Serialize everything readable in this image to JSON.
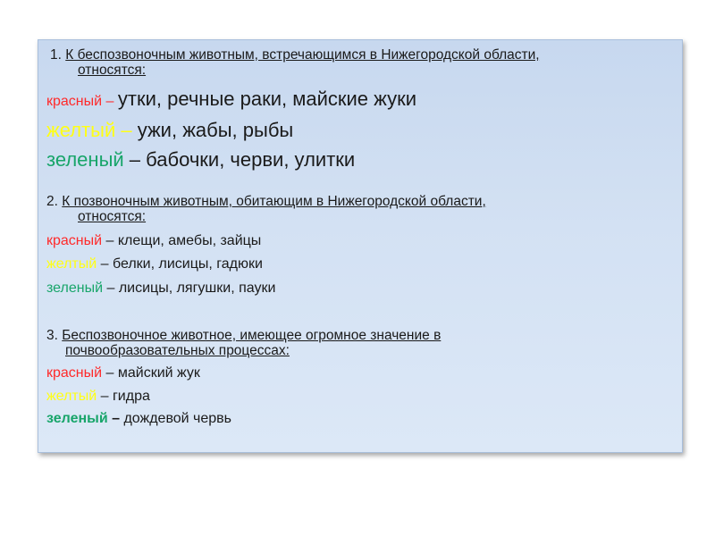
{
  "question1": {
    "number": "1.",
    "text": "К беспозвоночным животным, встречающимся в Нижегородской области,",
    "continuation": "относятся:",
    "answers": [
      {
        "color_name": "красный",
        "dash": " – ",
        "text": "утки, речные раки, майские жуки"
      },
      {
        "color_name": "желтый",
        "dash": " – ",
        "text": "ужи, жабы, рыбы"
      },
      {
        "color_name": "зеленый",
        "dash": " – ",
        "text": "бабочки, черви, улитки"
      }
    ]
  },
  "question2": {
    "number": "2.",
    "text": "К позвоночным животным, обитающим в Нижегородской области,",
    "continuation": "относятся:",
    "answers": [
      {
        "color_name": "красный",
        "dash": " – ",
        "text": "клещи, амебы, зайцы"
      },
      {
        "color_name": "желтый",
        "dash": " – ",
        "text": "белки, лисицы, гадюки"
      },
      {
        "color_name": "зеленый",
        "dash": " – ",
        "text": "лисицы, лягушки, пауки"
      }
    ]
  },
  "question3": {
    "number": "3.",
    "text": "Беспозвоночное животное, имеющее огромное значение в",
    "continuation": "почвообразовательных процессах:",
    "answers": [
      {
        "color_name": "красный",
        "dash": " – ",
        "text": "майский жук"
      },
      {
        "color_name": "желтый",
        "dash": " – ",
        "text": "гидра"
      },
      {
        "color_name": "зеленый",
        "dash": " – ",
        "text": "дождевой червь"
      }
    ]
  },
  "colors": {
    "red": "#ff2a2a",
    "yellow": "#ffff14",
    "green": "#18a56a",
    "panel": "#d3e1f3"
  }
}
